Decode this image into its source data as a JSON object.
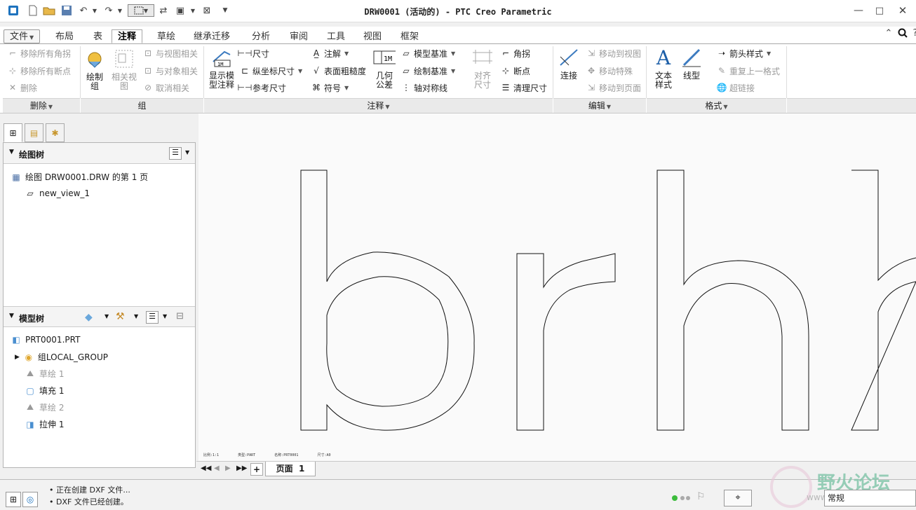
{
  "window": {
    "title": "DRW0001 (活动的) - PTC Creo Parametric"
  },
  "menubar": {
    "file": "文件",
    "tabs": [
      "布局",
      "表",
      "注释",
      "草绘",
      "继承迁移",
      "分析",
      "审阅",
      "工具",
      "视图",
      "框架"
    ],
    "active_tab": "注释"
  },
  "ribbon": {
    "delete_group": {
      "label": "删除",
      "items": [
        "移除所有角拐",
        "移除所有断点",
        "删除"
      ]
    },
    "group_group": {
      "label": "组",
      "draw_group": "绘制\n组",
      "related_view": "相关视\n图",
      "items": [
        "与视图相关",
        "与对象相关",
        "取消相关"
      ]
    },
    "annotate_group": {
      "label": "注释",
      "show_model_annotation": "显示模\n型注释",
      "col1": [
        "尺寸",
        "纵坐标尺寸",
        "参考尺寸"
      ],
      "col2": [
        "注解",
        "表面粗糙度",
        "符号"
      ],
      "geom_tol": "几何\n公差",
      "col3": [
        "模型基准",
        "绘制基准",
        "轴对称线"
      ],
      "align_dim": "对齐\n尺寸",
      "col4": [
        "角拐",
        "断点",
        "清理尺寸"
      ]
    },
    "edit_group": {
      "label": "编辑",
      "connect": "连接",
      "items": [
        "移动到视图",
        "移动特殊",
        "移动到页面"
      ]
    },
    "format_group": {
      "label": "格式",
      "text_style": "文本\n样式",
      "line_style": "线型",
      "items": [
        "箭头样式",
        "重复上一格式",
        "超链接"
      ]
    }
  },
  "drawing_tree": {
    "title": "绘图树",
    "items": [
      "绘图 DRW0001.DRW 的第 1 页",
      "new_view_1"
    ]
  },
  "model_tree": {
    "title": "模型树",
    "items": [
      "PRT0001.PRT",
      "组LOCAL_GROUP",
      "草绘 1",
      "填充 1",
      "草绘 2",
      "拉伸 1"
    ]
  },
  "drawing": {
    "letters": "brhh",
    "info_text": [
      "比例:1:1",
      "类型:PART",
      "名称:PRT0001",
      "尺寸:A0"
    ]
  },
  "pagebar": {
    "add": "+",
    "page_tab": "页面  1"
  },
  "status": {
    "messages": [
      "正在创建 DXF 文件...",
      "DXF 文件已经创建。"
    ],
    "mode": "常规",
    "watermark": "野火论坛",
    "watermark_url": "www.proewildfire.cn"
  }
}
